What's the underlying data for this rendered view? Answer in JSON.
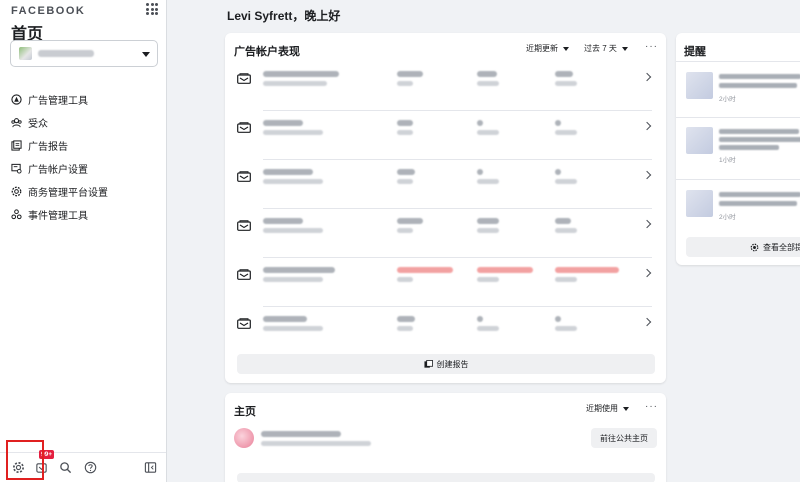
{
  "sidebar": {
    "brand": "FACEBOOK",
    "title": "首页",
    "nav": [
      {
        "label": "广告管理工具",
        "icon": "ads-manager-icon"
      },
      {
        "label": "受众",
        "icon": "audience-icon"
      },
      {
        "label": "广告报告",
        "icon": "reports-icon"
      },
      {
        "label": "广告帐户设置",
        "icon": "ad-account-settings-icon"
      },
      {
        "label": "商务管理平台设置",
        "icon": "business-settings-icon"
      },
      {
        "label": "事件管理工具",
        "icon": "events-manager-icon"
      }
    ],
    "badge": "99+"
  },
  "main": {
    "greeting": "Levi Syfrett，晚上好",
    "ad_performance": {
      "title": "广告帐户表现",
      "sort_dropdown": "近期更新",
      "range_dropdown": "过去 7 天",
      "more": "···",
      "create_report": "创建报告"
    },
    "reminders": {
      "title": "提醒",
      "items": [
        {
          "time": "2小时"
        },
        {
          "time": "1小时"
        },
        {
          "time": "2小时"
        }
      ],
      "see_all": "查看全部提"
    },
    "pages": {
      "title": "主页",
      "sort_dropdown": "近期使用",
      "more": "···",
      "goto_button": "前往公共主页"
    }
  },
  "colors": {
    "highlight": "#e02020",
    "badge": "#e41e3f",
    "background": "#f0f2f5"
  }
}
